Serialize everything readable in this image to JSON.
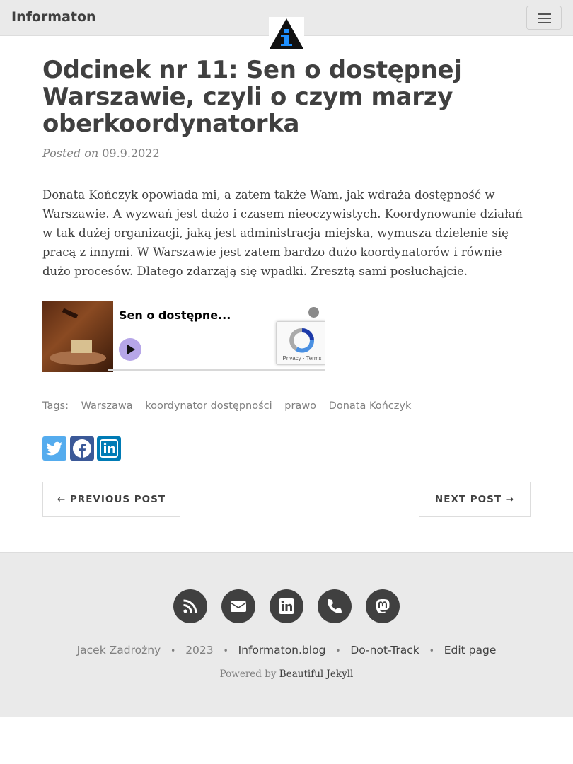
{
  "nav": {
    "brand": "Informaton",
    "logo_icon": "info-triangle-icon",
    "menu_icon": "hamburger-icon"
  },
  "post": {
    "title": "Odcinek nr 11: Sen o dostępnej Warszawie, czyli o czym marzy oberkoordynatorka",
    "title_lines": [
      "Odcinek nr 11: Sen o dostępnej",
      "Warszawie, czyli o czym marzy",
      "oberkoordynatorka"
    ],
    "posted_prefix": "Posted on",
    "date": "09.9.2022",
    "body_lines": [
      "Donata Kończyk opowiada mi, a zatem także Wam, jak wdraża dostępność w",
      "Warszawie. A wyzwań jest dużo i czasem nieoczywistych. Koordynowanie działań",
      "w tak dużej organizacji, jaką jest administracja miejska, wymusza dzielenie się",
      "pracą z innymi. W Warszawie jest zatem bardzo dużo koordynatorów i równie",
      "dużo procesów. Dlatego zdarzają się wpadki. Zresztą sami posłuchajcie."
    ]
  },
  "player": {
    "episode_title": "Sen o dostępne...",
    "recaptcha_links": "Privacy · Terms"
  },
  "tags": {
    "label": "Tags:",
    "items": [
      "Warszawa",
      "koordynator dostępności",
      "prawo",
      "Donata Kończyk"
    ]
  },
  "share": {
    "colors": {
      "twitter": "#55acee",
      "facebook": "#3b5998",
      "linkedin": "#007bb5"
    }
  },
  "pager": {
    "previous": "← PREVIOUS POST",
    "next": "NEXT POST →"
  },
  "footer": {
    "icons": [
      "rss-icon",
      "envelope-icon",
      "linkedin-icon",
      "phone-icon",
      "mastodon-icon"
    ],
    "author": "Jacek Zadrożny",
    "year": "2023",
    "site": "Informaton.blog",
    "dnt": "Do-not-Track",
    "edit": "Edit page",
    "separator": "•",
    "powered_prefix": "Powered by",
    "powered_link": "Beautiful Jekyll"
  }
}
